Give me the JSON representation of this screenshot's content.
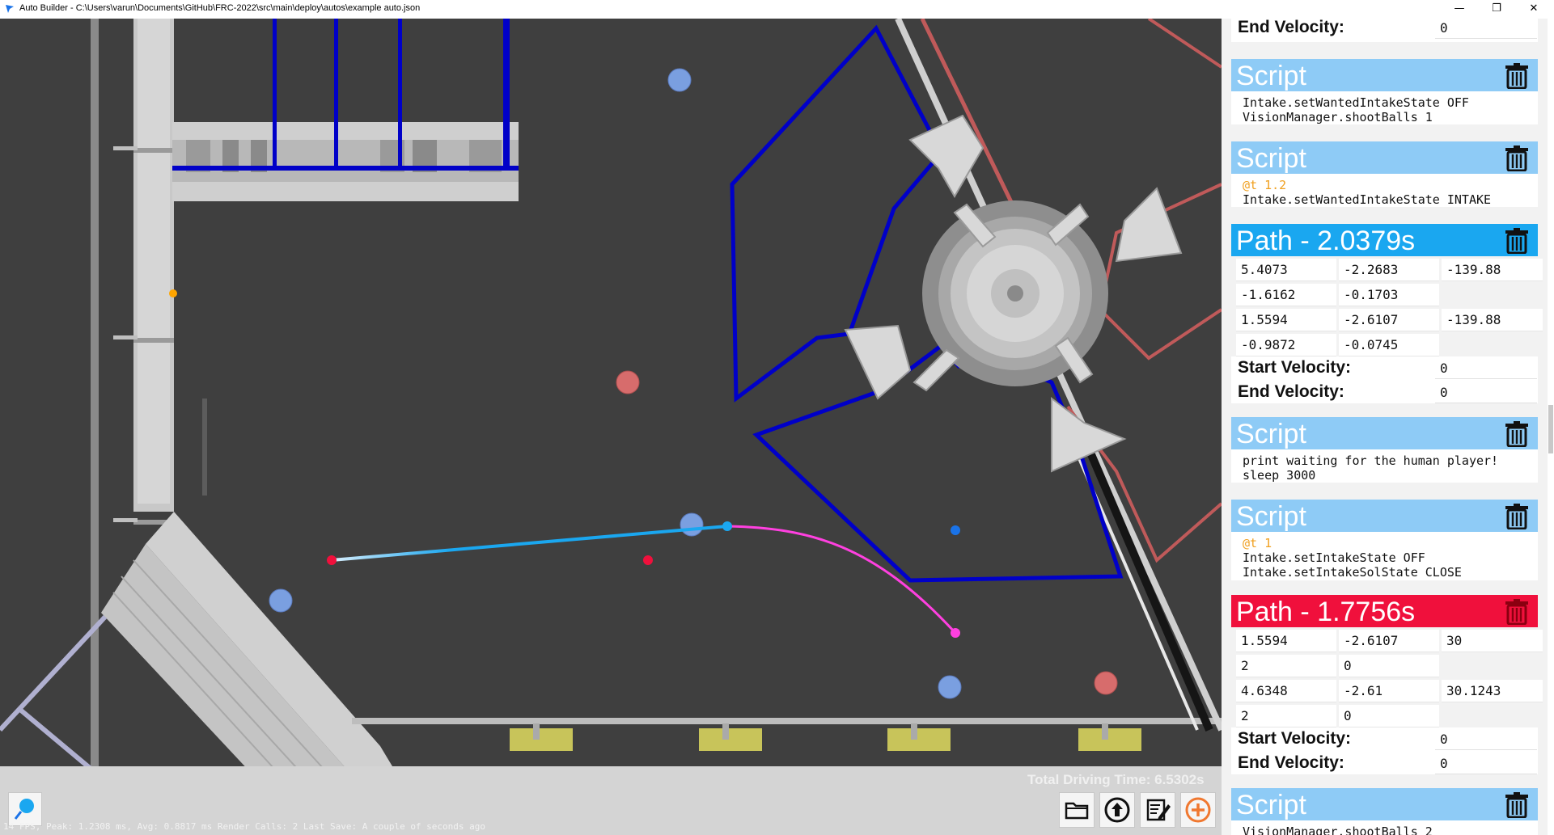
{
  "window": {
    "title": "Auto Builder - C:\\Users\\varun\\Documents\\GitHub\\FRC-2022\\src\\main\\deploy\\autos\\example auto.json",
    "minimize": "—",
    "maximize": "❐",
    "close": "✕"
  },
  "colors": {
    "script_header": "#8ecbf6",
    "path_selected_header": "#1aa7f0",
    "path_active_header": "#f0103c",
    "field_background": "#3f3f3f",
    "blue_alliance": "#0000c8",
    "red_alliance": "#d06060"
  },
  "panel": {
    "top_end_velocity": {
      "label": "End Velocity:",
      "value": "0"
    },
    "cards": [
      {
        "type": "script",
        "header": "Script",
        "lines": [
          {
            "tag": "",
            "text": "Intake.setWantedIntakeState OFF"
          },
          {
            "tag": "",
            "text": "VisionManager.shootBalls 1"
          }
        ]
      },
      {
        "type": "script",
        "header": "Script",
        "lines": [
          {
            "tag": "@t 1.2",
            "text": ""
          },
          {
            "tag": "",
            "text": "Intake.setWantedIntakeState INTAKE"
          }
        ]
      },
      {
        "type": "path",
        "header": "Path - 2.0379s",
        "style": "selected",
        "cells": [
          [
            "5.4073",
            "-2.2683",
            "-139.88"
          ],
          [
            "-1.6162",
            "-0.1703",
            ""
          ],
          [
            "1.5594",
            "-2.6107",
            "-139.88"
          ],
          [
            "-0.9872",
            "-0.0745",
            ""
          ]
        ],
        "start_velocity": {
          "label": "Start Velocity:",
          "value": "0"
        },
        "end_velocity": {
          "label": "End Velocity:",
          "value": "0"
        }
      },
      {
        "type": "script",
        "header": "Script",
        "lines": [
          {
            "tag": "",
            "text": "print waiting for the human player!"
          },
          {
            "tag": "",
            "text": "sleep 3000"
          }
        ]
      },
      {
        "type": "script",
        "header": "Script",
        "lines": [
          {
            "tag": "@t 1",
            "text": ""
          },
          {
            "tag": "",
            "text": "Intake.setIntakeState OFF"
          },
          {
            "tag": "",
            "text": "Intake.setIntakeSolState CLOSE"
          }
        ]
      },
      {
        "type": "path",
        "header": "Path - 1.7756s",
        "style": "active",
        "cells": [
          [
            "1.5594",
            "-2.6107",
            "30"
          ],
          [
            "2",
            "0",
            ""
          ],
          [
            "4.6348",
            "-2.61",
            "30.1243"
          ],
          [
            "2",
            "0",
            ""
          ]
        ],
        "start_velocity": {
          "label": "Start Velocity:",
          "value": "0"
        },
        "end_velocity": {
          "label": "End Velocity:",
          "value": "0"
        }
      },
      {
        "type": "script",
        "header": "Script",
        "lines": [
          {
            "tag": "",
            "text": "VisionManager.shootBalls 2"
          }
        ]
      }
    ]
  },
  "field": {
    "total_driving_time": "Total Driving Time: 6.5302s"
  },
  "status_bar": "14 FPS, Peak: 1.2308 ms, Avg: 0.8817 ms Render Calls: 2 Last Save: A couple of seconds ago",
  "toolbar": {
    "buttons": [
      "folder-icon",
      "upload-icon",
      "edit-notes-icon",
      "add-icon"
    ]
  }
}
